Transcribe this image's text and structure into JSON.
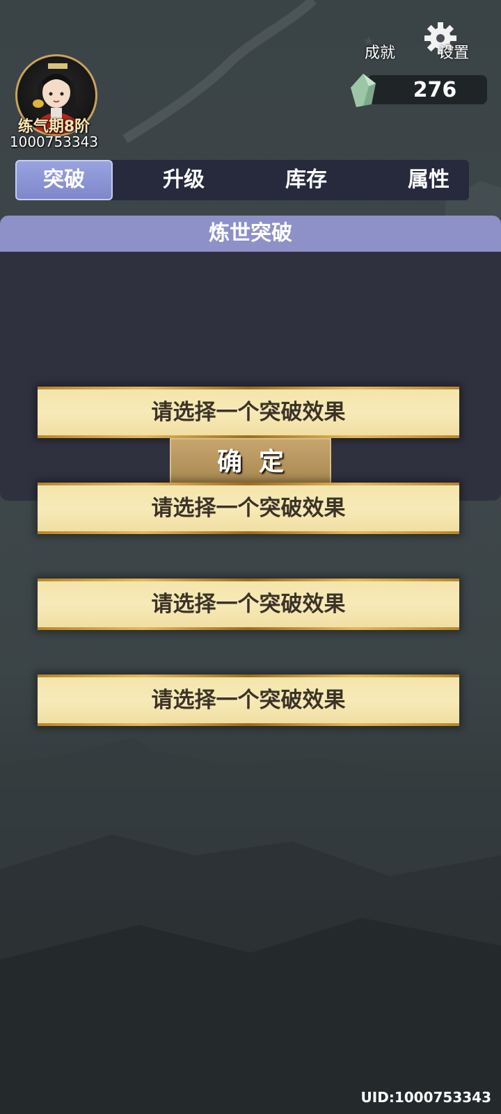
{
  "player": {
    "realm": "练气期8阶",
    "id": "1000753343"
  },
  "top_buttons": {
    "achievement_label": "成就",
    "settings_label": "设置"
  },
  "currency": {
    "icon": "green-crystal-icon",
    "value": "276"
  },
  "tabs": [
    {
      "label": "突破",
      "active": true
    },
    {
      "label": "升级",
      "active": false
    },
    {
      "label": "库存",
      "active": false
    },
    {
      "label": "属性",
      "active": false
    }
  ],
  "panel": {
    "title": "炼世突破",
    "confirm_label": "确定"
  },
  "options": [
    {
      "label": "请选择一个突破效果"
    },
    {
      "label": "请选择一个突破效果"
    },
    {
      "label": "请选择一个突破效果"
    },
    {
      "label": "请选择一个突破效果"
    }
  ],
  "footer": {
    "uid": "UID:1000753343"
  },
  "colors": {
    "panel_header": "#8e91c7",
    "panel_body": "#30313f",
    "option_bg": "#f5e6ad",
    "confirm_bg": "#b8975e",
    "tab_active": "#8a92d4"
  }
}
